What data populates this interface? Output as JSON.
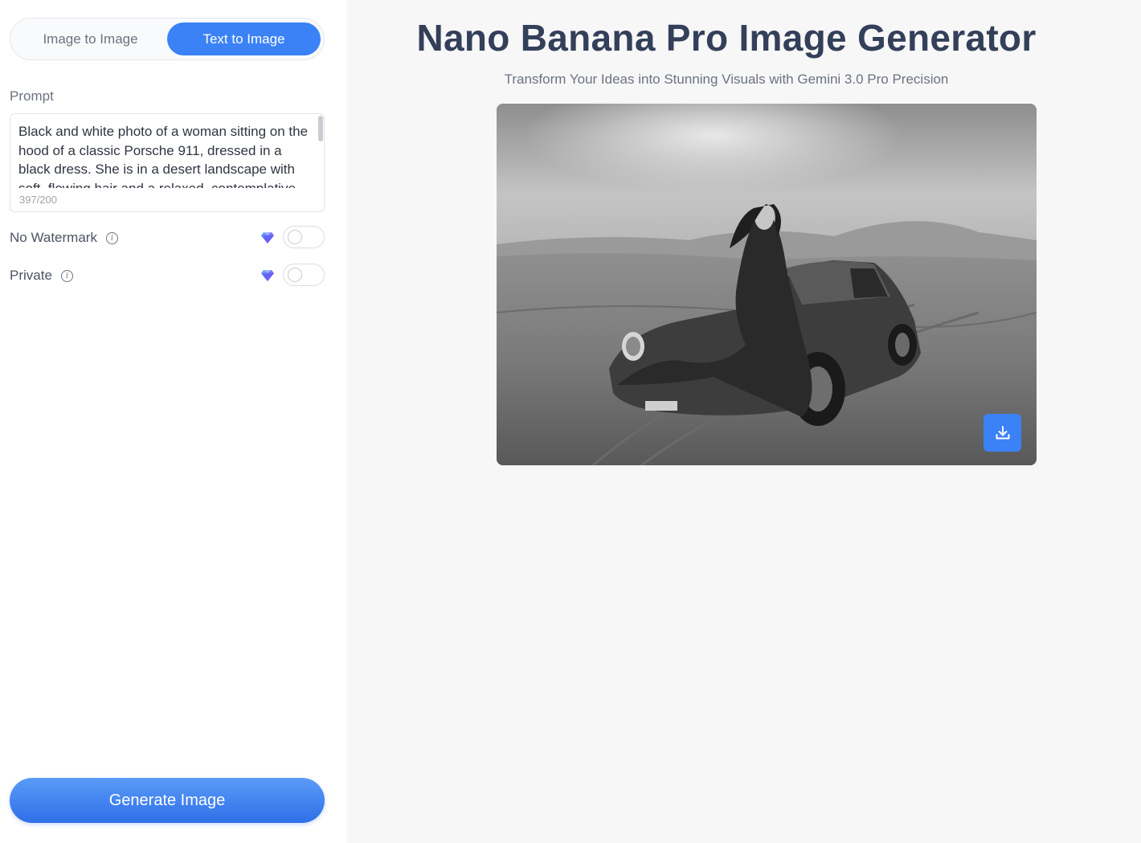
{
  "sidebar": {
    "modes": [
      {
        "label": "Image to Image",
        "active": false
      },
      {
        "label": "Text to Image",
        "active": true
      }
    ],
    "prompt": {
      "label": "Prompt",
      "value": "Black and white photo of a woman sitting on the hood of a classic Porsche 911, dressed in a black dress. She is in a desert landscape with soft, flowing hair and a relaxed, contemplative",
      "char_count": "397/200"
    },
    "options": [
      {
        "label": "No Watermark",
        "icon": "info-icon",
        "premium_icon": "gem-icon",
        "enabled": false
      },
      {
        "label": "Private",
        "icon": "info-icon",
        "premium_icon": "gem-icon",
        "enabled": false
      }
    ],
    "generate_label": "Generate Image"
  },
  "main": {
    "title": "Nano Banana Pro Image Generator",
    "subtitle": "Transform Your Ideas into Stunning Visuals with Gemini 3.0 Pro Precision",
    "result_image_alt": "black and white photo of woman sitting on classic Porsche 911 in desert",
    "download_icon": "download-icon"
  },
  "colors": {
    "accent": "#3b82f6",
    "title": "#34405a",
    "muted": "#6b7280"
  }
}
